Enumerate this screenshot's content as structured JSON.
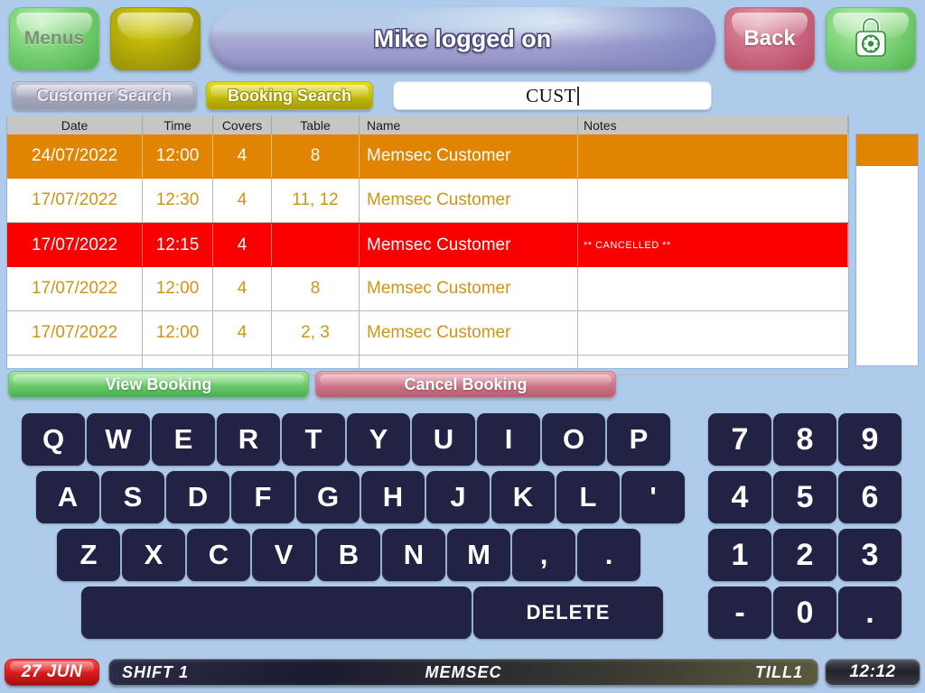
{
  "topbar": {
    "menus_label": "Menus",
    "blank_button_label": "",
    "title": "Mike logged on",
    "back_label": "Back",
    "lock_icon": "padlock-icon"
  },
  "search": {
    "customer_tab_label": "Customer Search",
    "booking_tab_label": "Booking Search",
    "input_value": "CUST",
    "input_placeholder": ""
  },
  "table": {
    "columns": [
      "Date",
      "Time",
      "Covers",
      "Table",
      "Name",
      "Notes"
    ],
    "rows": [
      {
        "date": "24/07/2022",
        "time": "12:00",
        "covers": "4",
        "table": "8",
        "name": "Memsec Customer",
        "notes": "",
        "state": "selected"
      },
      {
        "date": "17/07/2022",
        "time": "12:30",
        "covers": "4",
        "table": "11, 12",
        "name": "Memsec Customer",
        "notes": "",
        "state": "normal"
      },
      {
        "date": "17/07/2022",
        "time": "12:15",
        "covers": "4",
        "table": "",
        "name": "Memsec Customer",
        "notes": "** CANCELLED **",
        "state": "cancelled"
      },
      {
        "date": "17/07/2022",
        "time": "12:00",
        "covers": "4",
        "table": "8",
        "name": "Memsec Customer",
        "notes": "",
        "state": "normal"
      },
      {
        "date": "17/07/2022",
        "time": "12:00",
        "covers": "4",
        "table": "2, 3",
        "name": "Memsec Customer",
        "notes": "",
        "state": "normal"
      }
    ]
  },
  "actions": {
    "view_label": "View Booking",
    "cancel_label": "Cancel Booking"
  },
  "keyboard": {
    "row1": [
      "Q",
      "W",
      "E",
      "R",
      "T",
      "Y",
      "U",
      "I",
      "O",
      "P"
    ],
    "row2": [
      "A",
      "S",
      "D",
      "F",
      "G",
      "H",
      "J",
      "K",
      "L",
      "'"
    ],
    "row3": [
      "Z",
      "X",
      "C",
      "V",
      "B",
      "N",
      "M",
      ",",
      "."
    ],
    "space_label": "",
    "delete_label": "DELETE",
    "numpad": [
      "7",
      "8",
      "9",
      "4",
      "5",
      "6",
      "1",
      "2",
      "3",
      "-",
      "0",
      "."
    ]
  },
  "status": {
    "date": "27 JUN",
    "shift": "SHIFT 1",
    "site": "MEMSEC",
    "till": "TILL1",
    "time": "12:12"
  },
  "colors": {
    "background": "#aecbeb",
    "selected_row": "#e18401",
    "cancelled_row": "#fb0000",
    "row_text": "#d09416",
    "key": "#212244"
  }
}
